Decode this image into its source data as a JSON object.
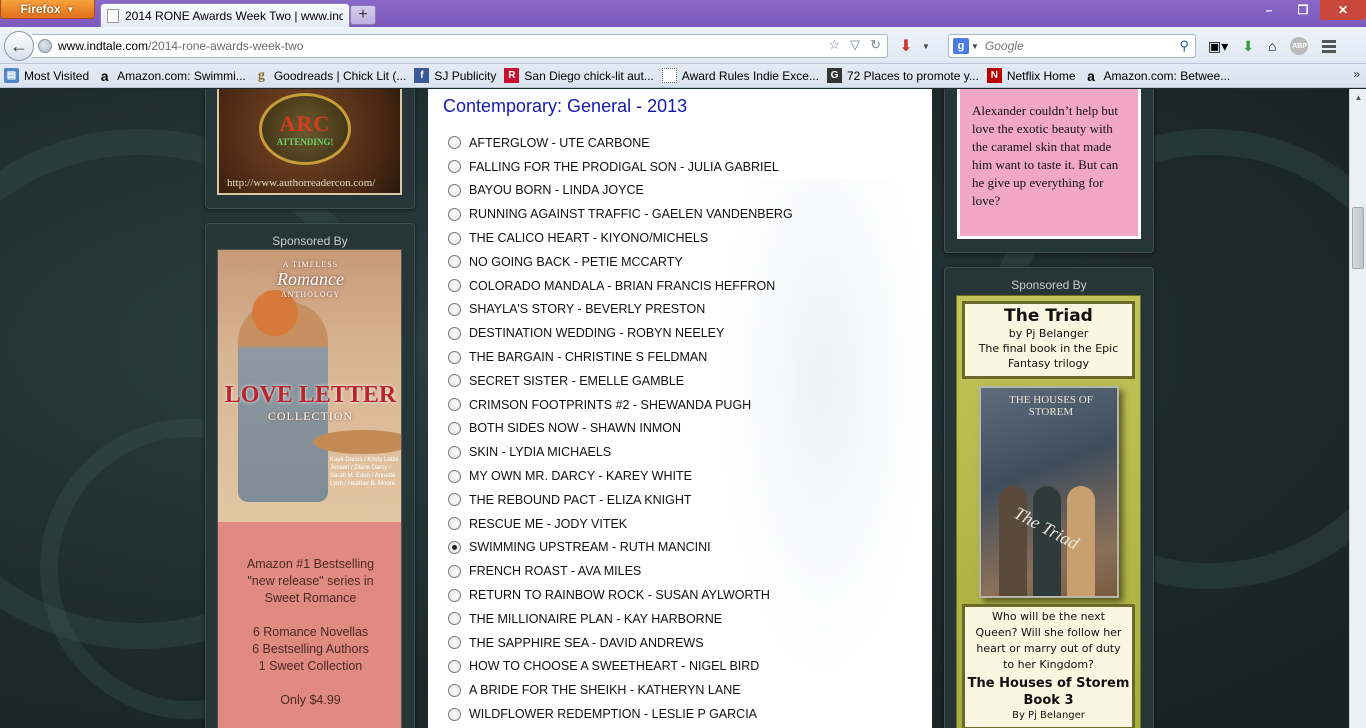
{
  "browser": {
    "menu_button": "Firefox",
    "tab_title": "2014 RONE Awards Week Two | www.ind...",
    "new_tab": "+",
    "window_controls": [
      "–",
      "❐",
      "✕"
    ]
  },
  "navbar": {
    "url_host": "www.indtale.com",
    "url_path": "/2014-rone-awards-week-two",
    "search_engine": "Google",
    "search_placeholder": "Google",
    "addon_label": "ABP"
  },
  "bookmarks": [
    {
      "label": "Most Visited",
      "icon": "most-visited-icon"
    },
    {
      "label": "Amazon.com: Swimmi...",
      "icon": "amazon-icon"
    },
    {
      "label": "Goodreads | Chick Lit (...",
      "icon": "goodreads-icon"
    },
    {
      "label": "SJ Publicity",
      "icon": "facebook-icon"
    },
    {
      "label": "San Diego chick-lit aut...",
      "icon": "r-icon"
    },
    {
      "label": "Award Rules Indie Exce...",
      "icon": "blank-page-icon"
    },
    {
      "label": "72 Places to promote y...",
      "icon": "g-icon"
    },
    {
      "label": "Netflix Home",
      "icon": "netflix-icon"
    },
    {
      "label": "Amazon.com: Betwee...",
      "icon": "amazon-icon"
    }
  ],
  "bookmarks_more": "»",
  "left_sidebar": {
    "arcon_ad": {
      "logo_text": "ARC",
      "badge": "ATTENDING!",
      "url": "http://www.authorreadercon.com/"
    },
    "sponsor_label": "Sponsored By",
    "love_letter_ad": {
      "series": "A TIMELESS",
      "series_title": "Romance",
      "series_sub": "ANTHOLOGY",
      "title": "LOVE LETTER",
      "subtitle": "COLLECTION",
      "authors": "Kaye Dacus / Kristy Lettie Jensen / Diane Darcy / Sarah M. Eden / Annette Lyon / Heather B. Moore",
      "line1": "Amazon #1 Bestselling",
      "line2": "\"new release\" series in",
      "line3": "Sweet Romance",
      "line4": "6 Romance Novellas",
      "line5": "6 Bestselling Authors",
      "line6": "1 Sweet Collection",
      "price": "Only $4.99"
    }
  },
  "main": {
    "category_heading": "Contemporary: General - 2013",
    "nominees": [
      {
        "title": "AFTERGLOW - UTE CARBONE",
        "selected": false
      },
      {
        "title": "FALLING FOR THE PRODIGAL SON - JULIA GABRIEL",
        "selected": false
      },
      {
        "title": "BAYOU BORN - LINDA JOYCE",
        "selected": false
      },
      {
        "title": "RUNNING AGAINST TRAFFIC - GAELEN VANDENBERG",
        "selected": false
      },
      {
        "title": "THE CALICO HEART - KIYONO/MICHELS",
        "selected": false
      },
      {
        "title": "NO GOING BACK - PETIE MCCARTY",
        "selected": false
      },
      {
        "title": "COLORADO MANDALA - BRIAN FRANCIS HEFFRON",
        "selected": false
      },
      {
        "title": "SHAYLA'S STORY - BEVERLY PRESTON",
        "selected": false
      },
      {
        "title": "DESTINATION WEDDING - ROBYN NEELEY",
        "selected": false
      },
      {
        "title": "THE BARGAIN - CHRISTINE S FELDMAN",
        "selected": false
      },
      {
        "title": "SECRET SISTER - EMELLE GAMBLE",
        "selected": false
      },
      {
        "title": "CRIMSON FOOTPRINTS #2 - SHEWANDA PUGH",
        "selected": false
      },
      {
        "title": "BOTH SIDES NOW - SHAWN INMON",
        "selected": false
      },
      {
        "title": "SKIN - LYDIA MICHAELS",
        "selected": false
      },
      {
        "title": "MY OWN MR. DARCY - KAREY WHITE",
        "selected": false
      },
      {
        "title": "THE REBOUND PACT - ELIZA KNIGHT",
        "selected": false
      },
      {
        "title": "RESCUE ME - JODY VITEK",
        "selected": false
      },
      {
        "title": "SWIMMING UPSTREAM - RUTH MANCINI",
        "selected": true
      },
      {
        "title": "FRENCH ROAST - AVA MILES",
        "selected": false
      },
      {
        "title": "RETURN TO RAINBOW ROCK - SUSAN AYLWORTH",
        "selected": false
      },
      {
        "title": "THE MILLIONAIRE PLAN - KAY HARBORNE",
        "selected": false
      },
      {
        "title": "THE SAPPHIRE SEA - DAVID ANDREWS",
        "selected": false
      },
      {
        "title": "HOW TO CHOOSE A SWEETHEART - NIGEL BIRD",
        "selected": false
      },
      {
        "title": "A BRIDE FOR THE SHEIKH - KATHERYN LANE",
        "selected": false
      },
      {
        "title": "WILDFLOWER REDEMPTION - LESLIE P GARCIA",
        "selected": false
      }
    ]
  },
  "right_sidebar": {
    "excerpt_ad": {
      "text": "Alexander couldn’t help but love the exotic beauty with the caramel skin that made him want to taste it. But can he give up everything for love?"
    },
    "sponsor_label": "Sponsored By",
    "triad_ad": {
      "title": "The Triad",
      "by": "by Pj Belanger",
      "tagline1": "The final book in the Epic",
      "tagline2": "Fantasy trilogy",
      "cover_series": "THE HOUSES OF STOREM",
      "cover_title": "The Triad",
      "blurb": "Who will be the next Queen? Will she follow her heart or marry out of duty to her Kingdom?",
      "series": "The Houses of Storem",
      "book": "Book 3",
      "author": "By Pj Belanger"
    }
  }
}
